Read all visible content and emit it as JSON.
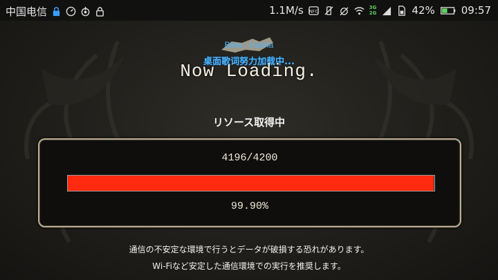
{
  "status_bar": {
    "carrier": "中国电信",
    "speed": "1.1M/s",
    "network": "3G",
    "network2": "2G",
    "battery": "42%",
    "time": "09:57",
    "icons": [
      "usb-lock-icon",
      "speedometer-icon",
      "sync-icon",
      "lock-icon",
      "nfc-icon",
      "vibrate-off-icon",
      "alarm-off-icon",
      "wifi-icon",
      "signal-icon",
      "sim-icon",
      "battery-icon"
    ]
  },
  "lyrics_overlay": {
    "song": "Blow - Kesha",
    "status": "桌面歌词努力加载中..."
  },
  "loading": {
    "now_loading": "Now Loading.",
    "title": "リソース取得中",
    "count": "4196/4200",
    "percent_text": "99.90%",
    "progress": 0.999,
    "bar_color": "#ff2a10"
  },
  "notice": {
    "line1": "通信の不安定な環境で行うとデータが破損する恐れがあります。",
    "line2": "Wi-Fiなど安定した通信環境での実行を推奨します。"
  }
}
